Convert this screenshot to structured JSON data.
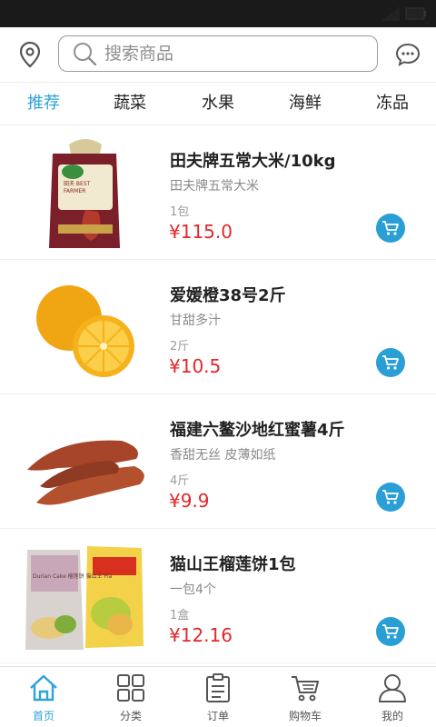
{
  "header": {
    "search_placeholder": "搜索商品"
  },
  "tabs": [
    {
      "label": "推荐",
      "active": true
    },
    {
      "label": "蔬菜"
    },
    {
      "label": "水果"
    },
    {
      "label": "海鲜"
    },
    {
      "label": "冻品"
    }
  ],
  "products": [
    {
      "name": "田夫牌五常大米/10kg",
      "desc": "田夫牌五常大米",
      "unit": "1包",
      "price": "¥115.0",
      "image_text": "田夫 BEST FARMER"
    },
    {
      "name": "爱媛橙38号2斤",
      "desc": "甘甜多汁",
      "unit": "2斤",
      "price": "¥10.5"
    },
    {
      "name": "福建六鳌沙地红蜜薯4斤",
      "desc": "香甜无丝 皮薄如纸",
      "unit": "4斤",
      "price": "¥9.9"
    },
    {
      "name": "猫山王榴莲饼1包",
      "desc": "一包4个",
      "unit": "1盒",
      "price": "¥12.16",
      "image_text": "Durian Cake 榴莲饼 猫山王 Pia"
    }
  ],
  "bottom_nav": [
    {
      "label": "首页",
      "icon": "home-icon",
      "active": true
    },
    {
      "label": "分类",
      "icon": "grid-icon"
    },
    {
      "label": "订单",
      "icon": "order-icon"
    },
    {
      "label": "购物车",
      "icon": "cart-icon"
    },
    {
      "label": "我的",
      "icon": "user-icon"
    }
  ],
  "colors": {
    "accent": "#2ba4d8",
    "price": "#e3262a",
    "cart_button": "#2a9fd6"
  }
}
